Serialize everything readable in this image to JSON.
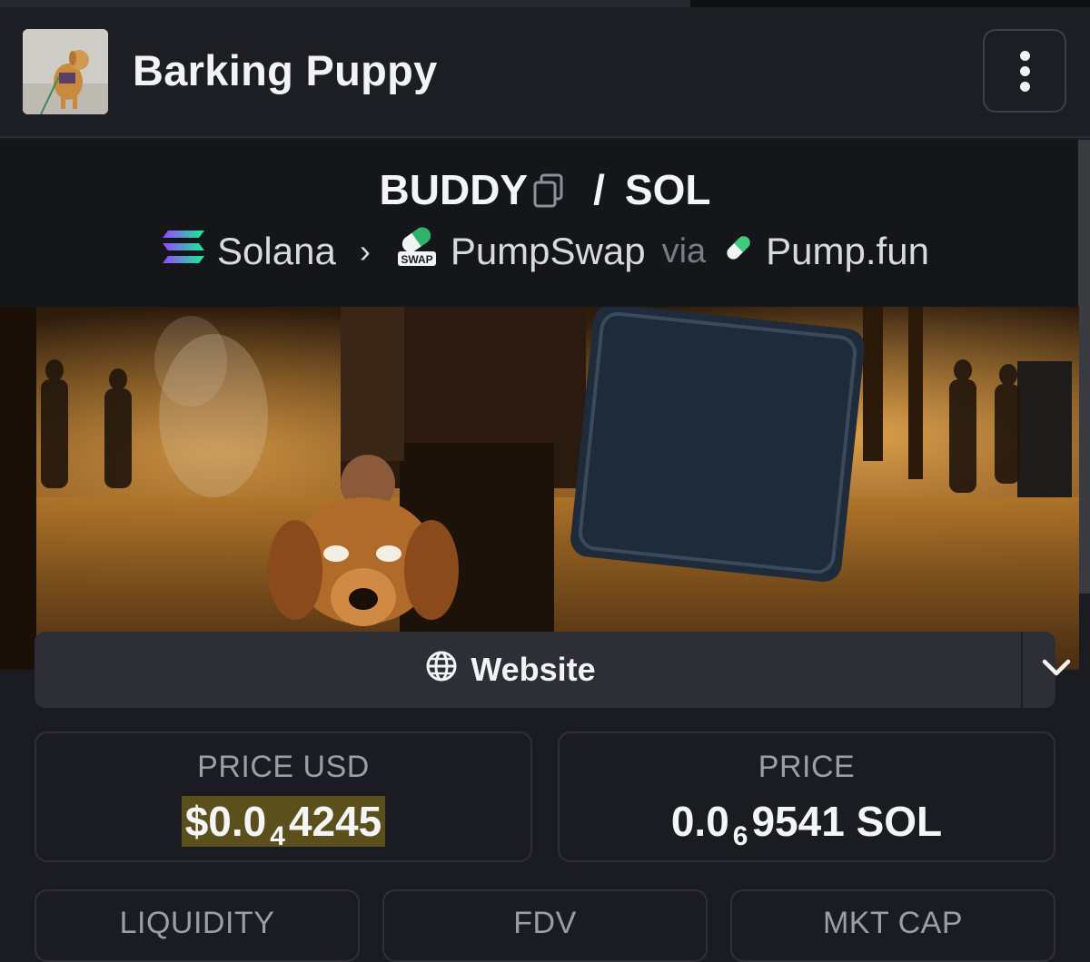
{
  "header": {
    "token_name": "Barking Puppy",
    "menu_icon": "more-vertical-icon"
  },
  "pair": {
    "base": "BUDDY",
    "quote": "SOL",
    "separator": "/"
  },
  "chain_path": {
    "chain": "Solana",
    "dex": "PumpSwap",
    "dex_badge": "SWAP",
    "via": "via",
    "launchpad": "Pump.fun"
  },
  "links": {
    "website_label": "Website"
  },
  "stats": {
    "price_usd": {
      "label": "PRICE USD",
      "prefix": "$0.0",
      "zeros": "4",
      "digits": "4245"
    },
    "price": {
      "label": "PRICE",
      "prefix": "0.0",
      "zeros": "6",
      "digits": "9541 SOL"
    },
    "liquidity": {
      "label": "LIQUIDITY"
    },
    "fdv": {
      "label": "FDV"
    },
    "mkt_cap": {
      "label": "MKT CAP"
    }
  },
  "colors": {
    "background": "#1b1c21",
    "highlight": "#5b501b",
    "solana_gradient": [
      "#9945ff",
      "#14f195"
    ]
  }
}
